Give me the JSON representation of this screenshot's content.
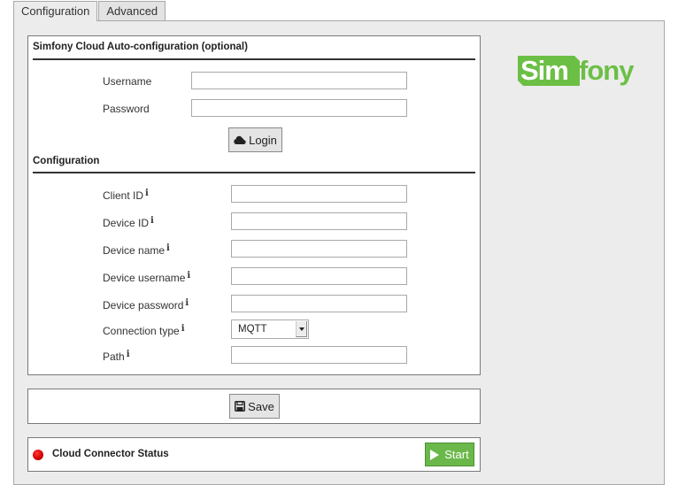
{
  "tabs": [
    {
      "label": "Configuration",
      "active": true
    },
    {
      "label": "Advanced",
      "active": false
    }
  ],
  "auto_config": {
    "title": "Simfony Cloud Auto-configuration (optional)",
    "username_label": "Username",
    "username_value": "",
    "password_label": "Password",
    "password_value": "",
    "login_button": "Login",
    "login_icon": "cloud-icon"
  },
  "configuration": {
    "title": "Configuration",
    "info_glyph": "i",
    "fields": [
      {
        "label": "Client ID",
        "value": ""
      },
      {
        "label": "Device ID",
        "value": ""
      },
      {
        "label": "Device name",
        "value": ""
      },
      {
        "label": "Device username",
        "value": ""
      },
      {
        "label": "Device password",
        "value": ""
      },
      {
        "label": "Connection type",
        "value": "MQTT",
        "type": "select"
      },
      {
        "label": "Path",
        "value": ""
      }
    ]
  },
  "save": {
    "label": "Save",
    "icon": "floppy-disk-icon"
  },
  "status": {
    "label": "Cloud Connector Status",
    "state_color": "#d80000",
    "start_button": "Start",
    "start_icon": "play-icon",
    "start_color": "#6bb84a"
  },
  "logo": {
    "part1": "Sim",
    "part2": "fony",
    "brand_color": "#6cbf45"
  }
}
